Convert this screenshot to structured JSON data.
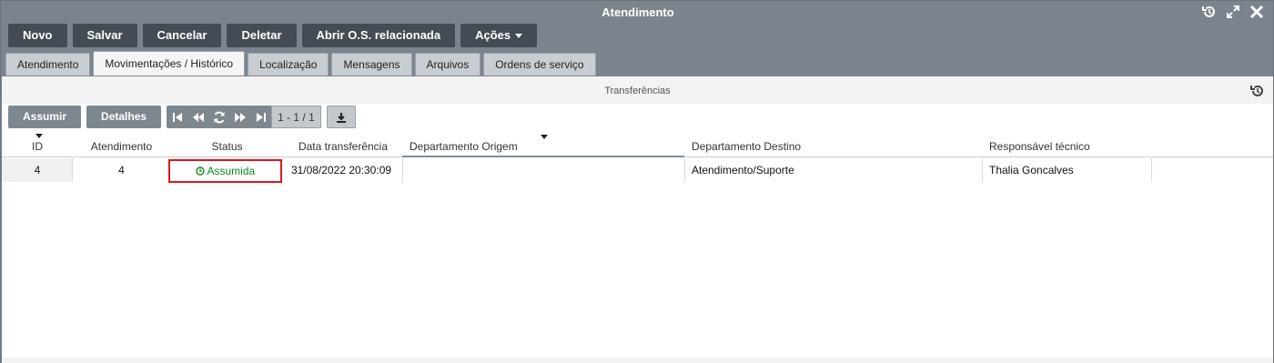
{
  "window": {
    "title": "Atendimento"
  },
  "toolbar": {
    "buttons": [
      "Novo",
      "Salvar",
      "Cancelar",
      "Deletar",
      "Abrir O.S. relacionada",
      "Ações"
    ]
  },
  "tabs": [
    "Atendimento",
    "Movimentações / Histórico",
    "Localização",
    "Mensagens",
    "Arquivos",
    "Ordens de serviço"
  ],
  "panel": {
    "title": "Transferências"
  },
  "grid_actions": {
    "assumir": "Assumir",
    "detalhes": "Detalhes"
  },
  "pager": {
    "count": "1 - 1 / 1"
  },
  "table": {
    "columns": [
      "ID",
      "Atendimento",
      "Status",
      "Data transferência",
      "Departamento Origem",
      "Departamento Destino",
      "Responsável técnico"
    ],
    "rows": [
      {
        "id": "4",
        "atendimento": "4",
        "status": "Assumida",
        "data": "31/08/2022 20:30:09",
        "origem": "",
        "destino": "Atendimento/Suporte",
        "responsavel": "Thalia Goncalves"
      }
    ]
  },
  "colors": {
    "status_ok": "#0c8a1e",
    "highlight": "#e0141e",
    "toolbar_button": "#434c55",
    "titlebar": "#7b848e"
  }
}
